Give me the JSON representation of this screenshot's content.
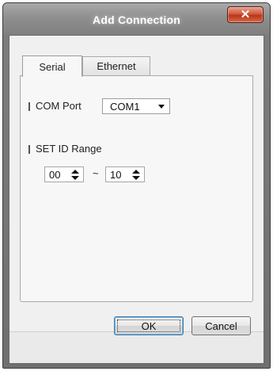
{
  "window": {
    "title": "Add Connection",
    "close_label": "✕"
  },
  "tabs": [
    {
      "label": "Serial",
      "active": true
    },
    {
      "label": "Ethernet",
      "active": false
    }
  ],
  "serial": {
    "com_port": {
      "label": "COM Port",
      "selected": "COM1"
    },
    "set_id_range": {
      "label": "SET ID Range",
      "from": "00",
      "separator": "~",
      "to": "10"
    }
  },
  "buttons": {
    "ok": "OK",
    "cancel": "Cancel"
  },
  "colors": {
    "titlebar": "#8f8f8f",
    "close_button": "#cf5a40",
    "dialog_background": "#f0f0f0",
    "ok_focus_border": "#3c7fb1"
  }
}
